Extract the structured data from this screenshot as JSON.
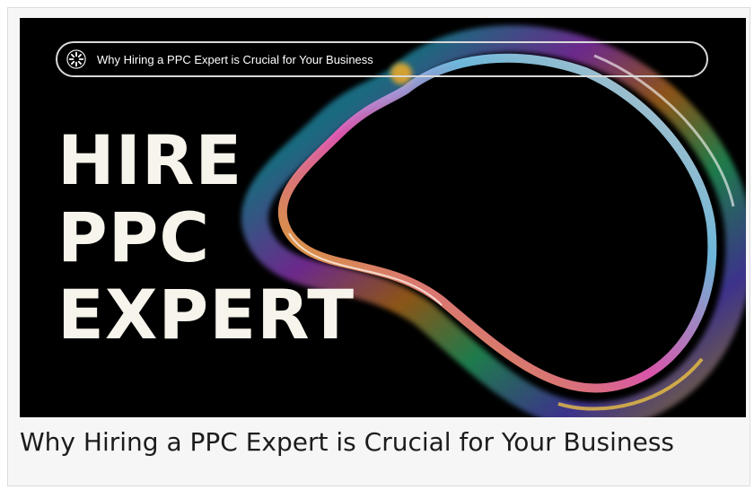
{
  "banner": {
    "pill_text": "Why Hiring a PPC Expert is Crucial for Your Business",
    "pill_icon": "sparkle-logo-icon",
    "headline": {
      "line1": "HIRE",
      "line2": "PPC",
      "line3": "EXPERT"
    },
    "background_color": "#000000",
    "headline_color": "#f7f4ec"
  },
  "caption": {
    "text": "Why Hiring a PPC Expert is Crucial for Your Business"
  }
}
